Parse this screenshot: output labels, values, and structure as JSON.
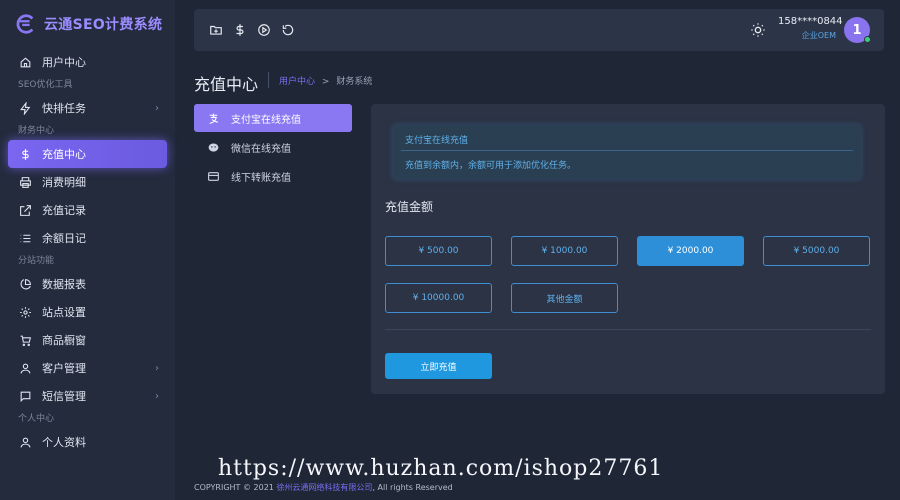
{
  "brand": {
    "title": "云通SEO计费系统"
  },
  "sidebar": {
    "items": [
      {
        "type": "item",
        "label": "用户中心",
        "icon": "home-icon"
      },
      {
        "type": "section",
        "label": "SEO优化工具"
      },
      {
        "type": "item",
        "label": "快排任务",
        "icon": "bolt-icon",
        "chevron": true
      },
      {
        "type": "section",
        "label": "财务中心"
      },
      {
        "type": "item",
        "label": "充值中心",
        "icon": "dollar-icon",
        "active": true
      },
      {
        "type": "item",
        "label": "消费明细",
        "icon": "printer-icon"
      },
      {
        "type": "item",
        "label": "充值记录",
        "icon": "external-link-icon"
      },
      {
        "type": "item",
        "label": "余额日记",
        "icon": "list-icon"
      },
      {
        "type": "section",
        "label": "分站功能"
      },
      {
        "type": "item",
        "label": "数据报表",
        "icon": "pie-chart-icon"
      },
      {
        "type": "item",
        "label": "站点设置",
        "icon": "gear-icon"
      },
      {
        "type": "item",
        "label": "商品橱窗",
        "icon": "cart-icon"
      },
      {
        "type": "item",
        "label": "客户管理",
        "icon": "user-icon",
        "chevron": true
      },
      {
        "type": "item",
        "label": "短信管理",
        "icon": "message-icon",
        "chevron": true
      },
      {
        "type": "section",
        "label": "个人中心"
      },
      {
        "type": "item",
        "label": "个人资料",
        "icon": "user-icon"
      }
    ]
  },
  "topbar": {
    "icons": [
      "folder-plus-icon",
      "dollar-icon",
      "play-circle-icon",
      "refresh-icon"
    ],
    "user_phone": "158****0844",
    "user_role": "企业OEM",
    "avatar_text": "1"
  },
  "page": {
    "title": "充值中心",
    "breadcrumb_link": "用户中心",
    "breadcrumb_sep": ">",
    "breadcrumb_current": "财务系统"
  },
  "tabs": [
    {
      "label": "支付宝在线充值",
      "icon": "alipay-icon",
      "active": true
    },
    {
      "label": "微信在线充值",
      "icon": "wechat-icon"
    },
    {
      "label": "线下转账充值",
      "icon": "card-icon"
    }
  ],
  "notice": {
    "title": "支付宝在线充值",
    "text": "充值到余额内，余额可用于添加优化任务。"
  },
  "amount": {
    "label": "充值金额",
    "options": [
      "¥ 500.00",
      "¥ 1000.00",
      "¥ 2000.00",
      "¥ 5000.00",
      "¥ 10000.00",
      "其他金额"
    ],
    "selected_index": 2,
    "submit_label": "立即充值"
  },
  "footer": {
    "prefix": "COPYRIGHT © 2021",
    "company": "徐州云通网络科技有限公司",
    "suffix": ", All rights Reserved"
  },
  "watermark": "https://www.huzhan.com/ishop27761",
  "colors": {
    "accent": "#8a78f2",
    "info": "#5fb0ec",
    "primary_button": "#1f98e0",
    "background": "#1f2636"
  }
}
